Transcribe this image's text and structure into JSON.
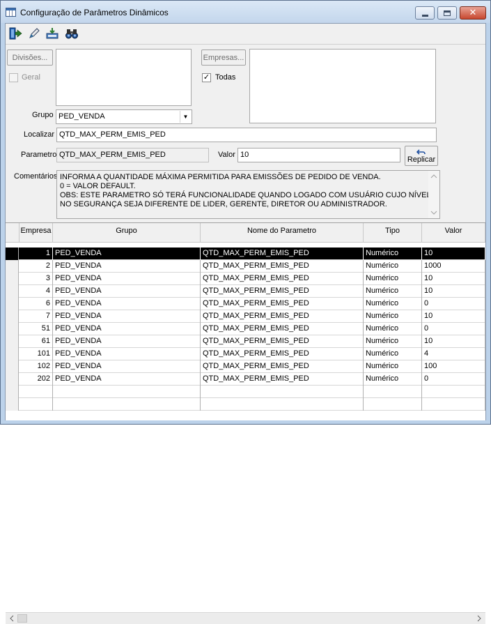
{
  "window": {
    "title": "Configuração de Parâmetros Dinâmicos",
    "close_glyph": "✕"
  },
  "toolbar": {
    "buttons": [
      {
        "name": "exit-icon",
        "color": "#1f5fae"
      },
      {
        "name": "edit-icon",
        "color": "#2f6f9f"
      },
      {
        "name": "save-icon",
        "color": "#2e7d32"
      },
      {
        "name": "find-icon",
        "color": "#1f4f8f"
      }
    ]
  },
  "filters": {
    "divisoes_label": "Divisões...",
    "geral_label": "Geral",
    "empresas_label": "Empresas...",
    "todas_label": "Todas",
    "todas_checked": true,
    "grupo_label": "Grupo",
    "grupo_value": "PED_VENDA",
    "localizar_label": "Localizar",
    "localizar_value": "QTD_MAX_PERM_EMIS_PED",
    "parametro_label": "Parametro",
    "parametro_value": "QTD_MAX_PERM_EMIS_PED",
    "valor_label": "Valor",
    "valor_value": "10",
    "replicar_label": "Replicar",
    "comentarios_label": "Comentários",
    "comentarios_lines": [
      "INFORMA A QUANTIDADE MÁXIMA PERMITIDA PARA EMISSÕES DE PEDIDO DE VENDA.",
      "0 = VALOR DEFAULT.",
      "OBS: ESTE PARAMETRO SÓ TERÁ FUNCIONALIDADE QUANDO LOGADO COM USUÁRIO CUJO NÍVEL",
      "NO SEGURANÇA SEJA DIFERENTE DE LIDER, GERENTE, DIRETOR OU ADMINISTRADOR."
    ]
  },
  "grid": {
    "columns": [
      "Empresa",
      "Grupo",
      "Nome do Parametro",
      "Tipo",
      "Valor"
    ],
    "rows": [
      {
        "empresa": "1",
        "grupo": "PED_VENDA",
        "nome": "QTD_MAX_PERM_EMIS_PED",
        "tipo": "Numérico",
        "valor": "10"
      },
      {
        "empresa": "2",
        "grupo": "PED_VENDA",
        "nome": "QTD_MAX_PERM_EMIS_PED",
        "tipo": "Numérico",
        "valor": "1000"
      },
      {
        "empresa": "3",
        "grupo": "PED_VENDA",
        "nome": "QTD_MAX_PERM_EMIS_PED",
        "tipo": "Numérico",
        "valor": "10"
      },
      {
        "empresa": "4",
        "grupo": "PED_VENDA",
        "nome": "QTD_MAX_PERM_EMIS_PED",
        "tipo": "Numérico",
        "valor": "10"
      },
      {
        "empresa": "6",
        "grupo": "PED_VENDA",
        "nome": "QTD_MAX_PERM_EMIS_PED",
        "tipo": "Numérico",
        "valor": "0"
      },
      {
        "empresa": "7",
        "grupo": "PED_VENDA",
        "nome": "QTD_MAX_PERM_EMIS_PED",
        "tipo": "Numérico",
        "valor": "10"
      },
      {
        "empresa": "51",
        "grupo": "PED_VENDA",
        "nome": "QTD_MAX_PERM_EMIS_PED",
        "tipo": "Numérico",
        "valor": "0"
      },
      {
        "empresa": "61",
        "grupo": "PED_VENDA",
        "nome": "QTD_MAX_PERM_EMIS_PED",
        "tipo": "Numérico",
        "valor": "10"
      },
      {
        "empresa": "101",
        "grupo": "PED_VENDA",
        "nome": "QTD_MAX_PERM_EMIS_PED",
        "tipo": "Numérico",
        "valor": "4"
      },
      {
        "empresa": "102",
        "grupo": "PED_VENDA",
        "nome": "QTD_MAX_PERM_EMIS_PED",
        "tipo": "Numérico",
        "valor": "100"
      },
      {
        "empresa": "202",
        "grupo": "PED_VENDA",
        "nome": "QTD_MAX_PERM_EMIS_PED",
        "tipo": "Numérico",
        "valor": "0"
      }
    ],
    "selected_row": 0
  }
}
